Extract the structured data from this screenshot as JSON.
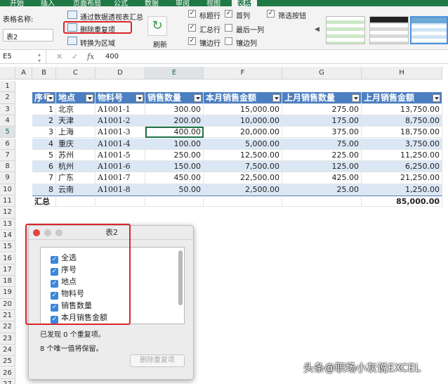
{
  "tabs": [
    "开始",
    "插入",
    "页面布局",
    "公式",
    "数据",
    "审阅",
    "视图",
    "表格"
  ],
  "active_tab": "表格",
  "ribbon": {
    "table_name_label": "表格名称:",
    "table_name_value": "表2",
    "cmd_pivot": "通过数据透视表汇总",
    "cmd_remove_dup": "删除重复项",
    "cmd_convert": "转换为区域",
    "refresh": "刷新",
    "opt_header_row": "标题行",
    "opt_total_row": "汇总行",
    "opt_banded_rows": "镶边行",
    "opt_first_col": "首列",
    "opt_last_col": "最后一列",
    "opt_banded_cols": "镶边列",
    "opt_filter_btn": "筛选按钮"
  },
  "formula_bar": {
    "name_box": "E5",
    "fx": "fx",
    "value": "400"
  },
  "columns": [
    "A",
    "B",
    "C",
    "D",
    "E",
    "F",
    "G",
    "H"
  ],
  "rows": [
    "1",
    "2",
    "3",
    "4",
    "5",
    "6",
    "7",
    "8",
    "9",
    "10",
    "11",
    "12",
    "13",
    "14",
    "15",
    "16",
    "17",
    "18",
    "19",
    "20",
    "21",
    "22",
    "23",
    "24",
    "25",
    "26",
    "27",
    "28"
  ],
  "table": {
    "headers": [
      "序号",
      "地点",
      "物料号",
      "销售数量",
      "本月销售金额",
      "上月销售数量",
      "上月销售金额"
    ],
    "rows": [
      [
        "1",
        "北京",
        "A1001-1",
        "300.00",
        "15,000.00",
        "275.00",
        "13,750.00"
      ],
      [
        "2",
        "天津",
        "A1001-2",
        "200.00",
        "10,000.00",
        "175.00",
        "8,750.00"
      ],
      [
        "3",
        "上海",
        "A1001-3",
        "400.00",
        "20,000.00",
        "375.00",
        "18,750.00"
      ],
      [
        "4",
        "重庆",
        "A1001-4",
        "100.00",
        "5,000.00",
        "75.00",
        "3,750.00"
      ],
      [
        "5",
        "苏州",
        "A1001-5",
        "250.00",
        "12,500.00",
        "225.00",
        "11,250.00"
      ],
      [
        "6",
        "杭州",
        "A1001-6",
        "150.00",
        "7,500.00",
        "125.00",
        "6,250.00"
      ],
      [
        "7",
        "广东",
        "A1001-7",
        "450.00",
        "22,500.00",
        "425.00",
        "21,250.00"
      ],
      [
        "8",
        "云南",
        "A1001-8",
        "50.00",
        "2,500.00",
        "25.00",
        "1,250.00"
      ]
    ],
    "total_label": "汇总",
    "total_value": "85,000.00"
  },
  "dialog": {
    "title": "表2",
    "items": [
      "全选",
      "序号",
      "地点",
      "物料号",
      "销售数量",
      "本月销售金额"
    ],
    "found_text": "已发现 0 个重复项。",
    "unique_text": "8 个唯一值将保留。",
    "button": "删除重复项"
  },
  "watermark": "头条@职场小灰说EXCEL"
}
